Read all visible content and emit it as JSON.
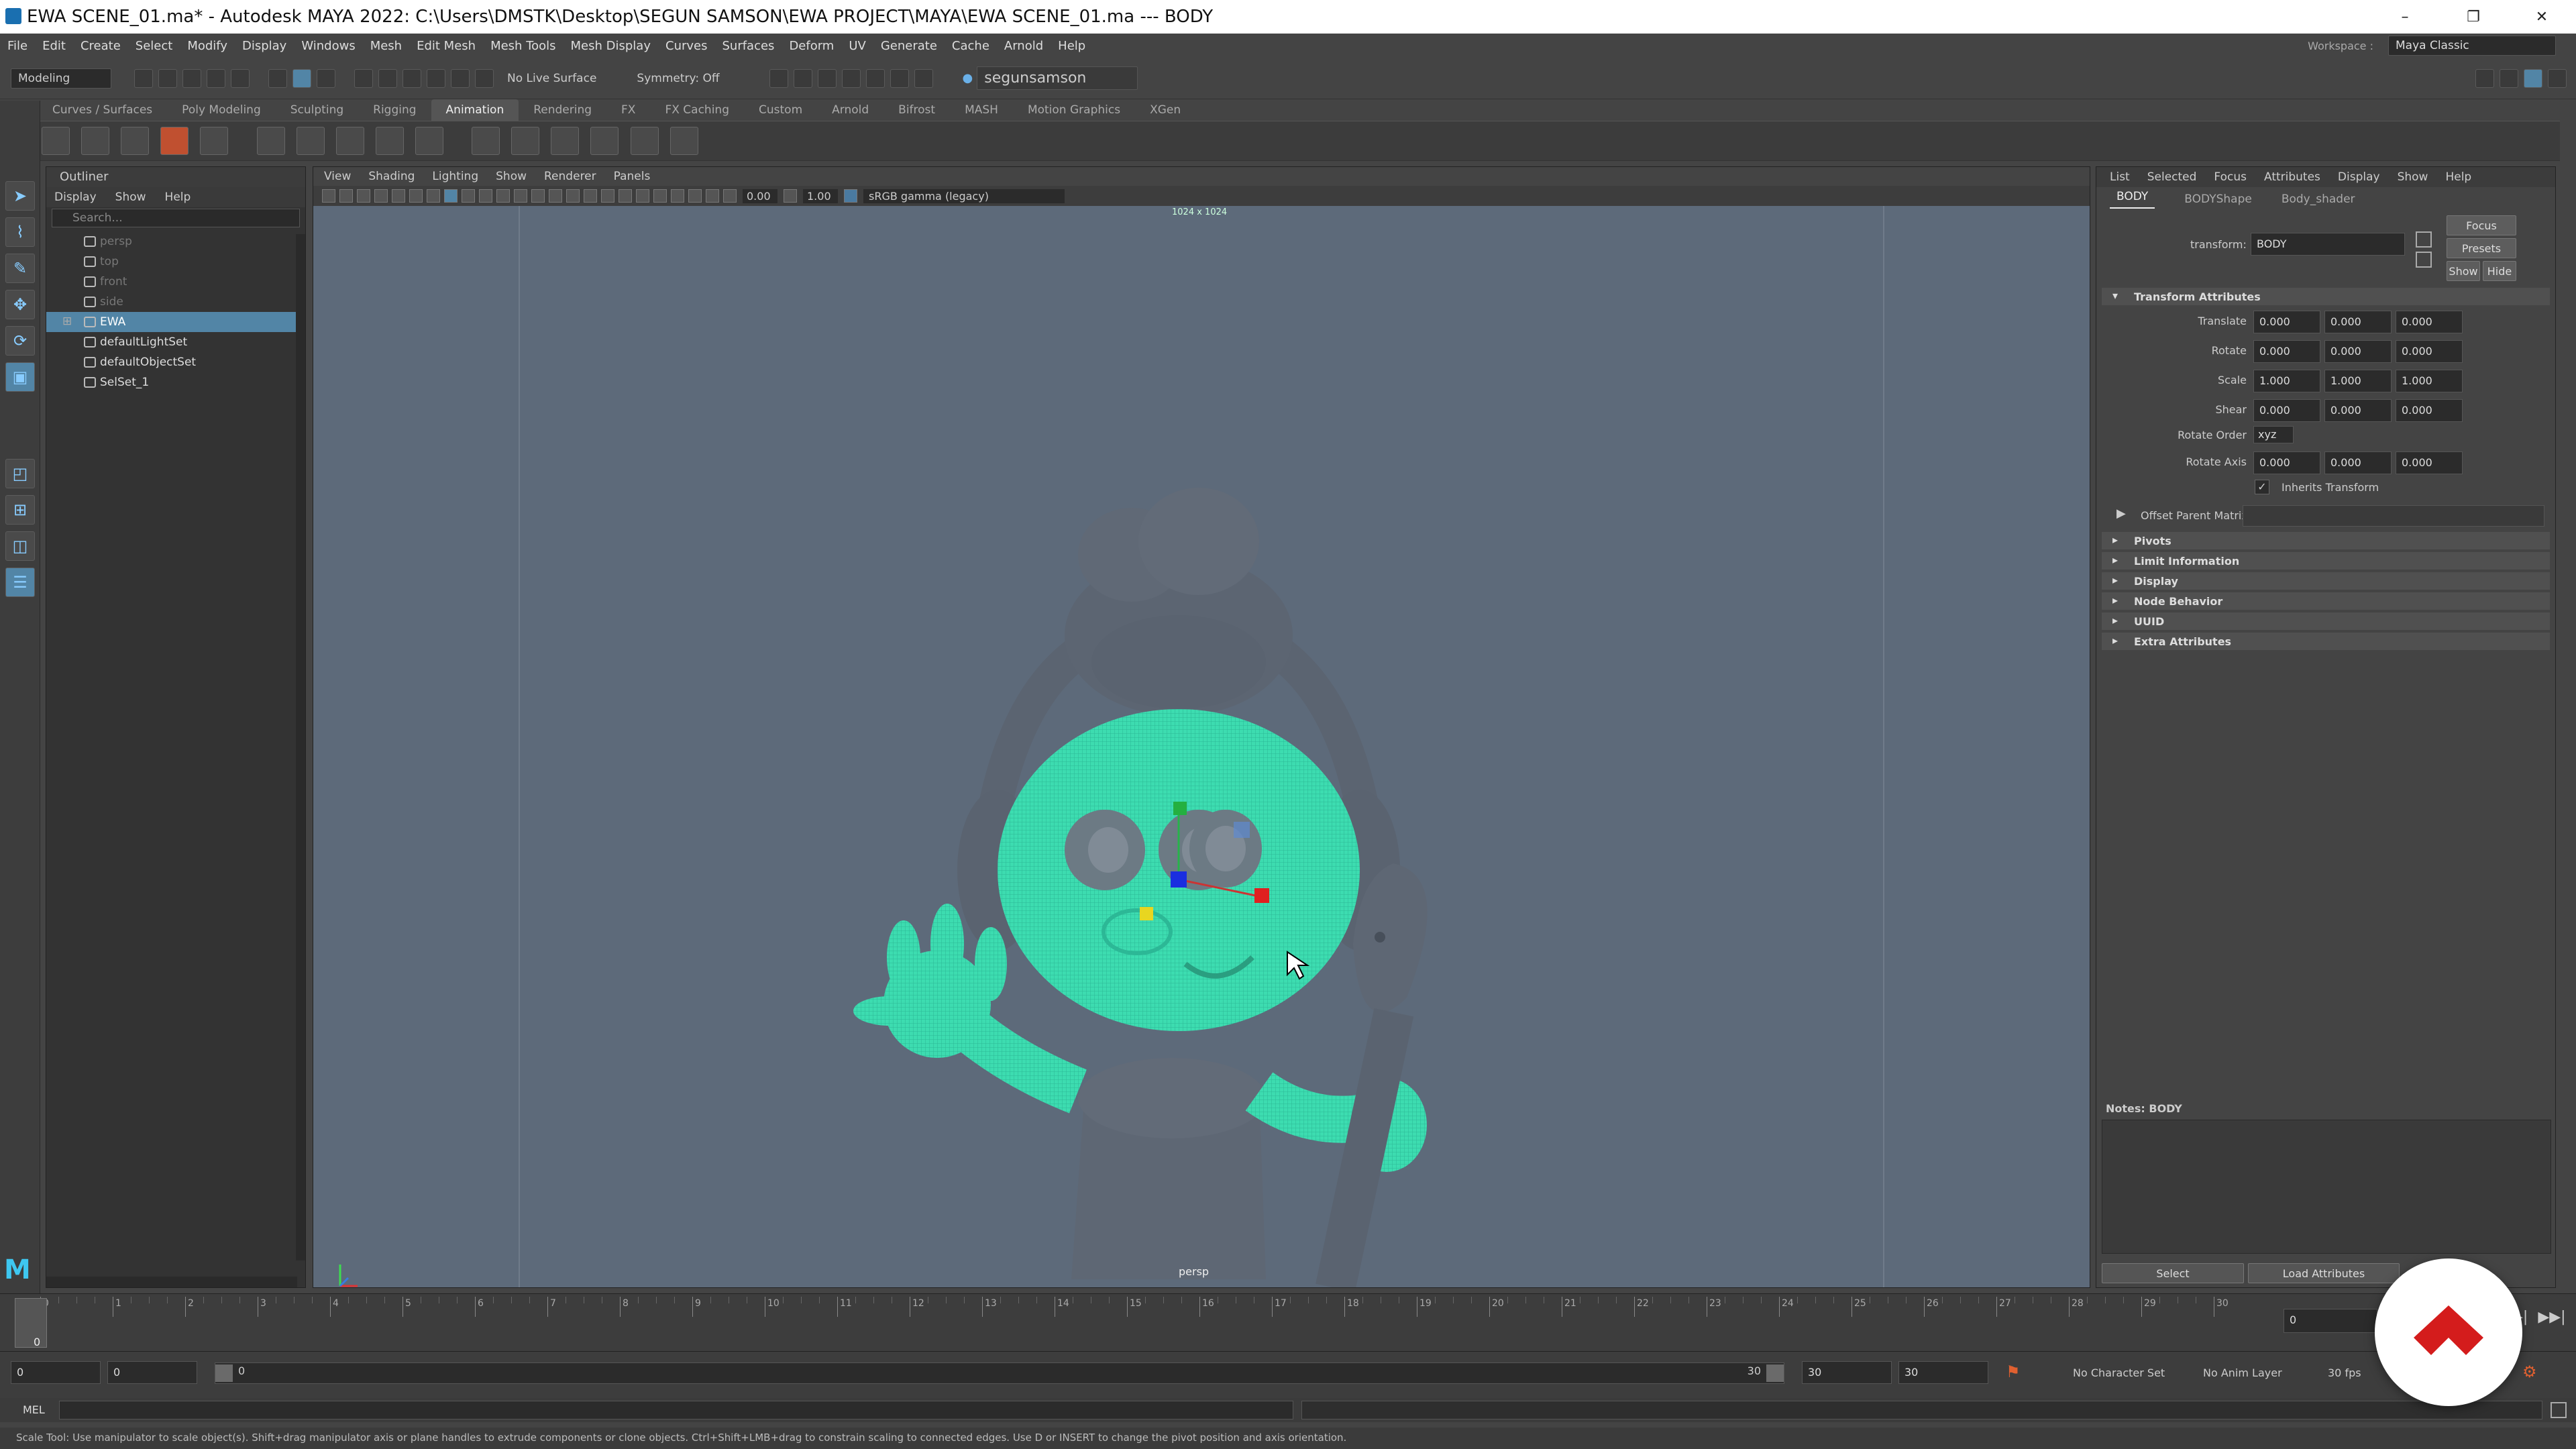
{
  "window": {
    "title": "EWA SCENE_01.ma* - Autodesk MAYA 2022: C:\\Users\\DMSTK\\Desktop\\SEGUN SAMSON\\EWA PROJECT\\MAYA\\EWA SCENE_01.ma   ---   BODY",
    "minimize": "–",
    "maximize": "❐",
    "close": "✕"
  },
  "menu": [
    "File",
    "Edit",
    "Create",
    "Select",
    "Modify",
    "Display",
    "Windows",
    "Mesh",
    "Edit Mesh",
    "Mesh Tools",
    "Mesh Display",
    "Curves",
    "Surfaces",
    "Deform",
    "UV",
    "Generate",
    "Cache",
    "Arnold",
    "Help"
  ],
  "workspace": {
    "label": "Workspace :",
    "value": "Maya Classic"
  },
  "status": {
    "mode": "Modeling",
    "live_surface": "No Live Surface",
    "symmetry": "Symmetry: Off",
    "user": "segunsamson"
  },
  "shelf_tabs": [
    "Curves / Surfaces",
    "Poly Modeling",
    "Sculpting",
    "Rigging",
    "Animation",
    "Rendering",
    "FX",
    "FX Caching",
    "Custom",
    "Arnold",
    "Bifrost",
    "MASH",
    "Motion Graphics",
    "XGen"
  ],
  "shelf_active": "Animation",
  "outliner": {
    "title": "Outliner",
    "menu": [
      "Display",
      "Show",
      "Help"
    ],
    "search_placeholder": "Search...",
    "items": [
      {
        "label": "persp",
        "dim": true
      },
      {
        "label": "top",
        "dim": true
      },
      {
        "label": "front",
        "dim": true
      },
      {
        "label": "side",
        "dim": true
      },
      {
        "label": "EWA",
        "selected": true,
        "expand": "⊞"
      },
      {
        "label": "defaultLightSet"
      },
      {
        "label": "defaultObjectSet"
      },
      {
        "label": "SelSet_1"
      }
    ]
  },
  "viewport": {
    "menu": [
      "View",
      "Shading",
      "Lighting",
      "Show",
      "Renderer",
      "Panels"
    ],
    "exposure": "0.00",
    "gamma": "1.00",
    "colorspace": "sRGB gamma (legacy)",
    "resolution": "1024 x 1024",
    "camera": "persp"
  },
  "attr": {
    "menu": [
      "List",
      "Selected",
      "Focus",
      "Attributes",
      "Display",
      "Show",
      "Help"
    ],
    "tabs": [
      "BODY",
      "BODYShape",
      "Body_shader"
    ],
    "transform_label": "transform:",
    "transform_value": "BODY",
    "buttons": {
      "focus": "Focus",
      "presets": "Presets",
      "show": "Show",
      "hide": "Hide"
    },
    "section_transform": "Transform Attributes",
    "translate": {
      "label": "Translate",
      "x": "0.000",
      "y": "0.000",
      "z": "0.000"
    },
    "rotate": {
      "label": "Rotate",
      "x": "0.000",
      "y": "0.000",
      "z": "0.000"
    },
    "scale": {
      "label": "Scale",
      "x": "1.000",
      "y": "1.000",
      "z": "1.000"
    },
    "shear": {
      "label": "Shear",
      "x": "0.000",
      "y": "0.000",
      "z": "0.000"
    },
    "rotate_order": {
      "label": "Rotate Order",
      "value": "xyz"
    },
    "rotate_axis": {
      "label": "Rotate Axis",
      "x": "0.000",
      "y": "0.000",
      "z": "0.000"
    },
    "inherits": "Inherits Transform",
    "offset_parent": "Offset Parent Matrix",
    "sections": [
      "Pivots",
      "Limit Information",
      "Display",
      "Node Behavior",
      "UUID",
      "Extra Attributes"
    ],
    "notes_label": "Notes:  BODY",
    "select_btn": "Select",
    "load_btn": "Load Attributes"
  },
  "timeline": {
    "ticks": [
      "0",
      "1",
      "2",
      "3",
      "4",
      "5",
      "6",
      "7",
      "8",
      "9",
      "10",
      "11",
      "12",
      "13",
      "14",
      "15",
      "16",
      "17",
      "18",
      "19",
      "20",
      "21",
      "22",
      "23",
      "24",
      "25",
      "26",
      "27",
      "28",
      "29",
      "30"
    ],
    "current": "0",
    "current_field": "0"
  },
  "range": {
    "start": "0",
    "anim_start": "0",
    "range_start": "0",
    "range_end": "30",
    "end": "30",
    "anim_end": "30",
    "character": "No Character Set",
    "anim_layer": "No Anim Layer",
    "fps": "30 fps"
  },
  "cmd": {
    "lang": "MEL"
  },
  "help": "Scale Tool: Use manipulator to scale object(s). Shift+drag manipulator axis or plane handles to extrude components or clone objects. Ctrl+Shift+LMB+drag to constrain scaling to connected edges. Use D or INSERT to change the pivot position and axis orientation.",
  "colors": {
    "wireframe": "#3ddcb0",
    "viewport_bg": "#5d6a7a",
    "model": "#5e6774",
    "logo": "#d41c1c"
  }
}
